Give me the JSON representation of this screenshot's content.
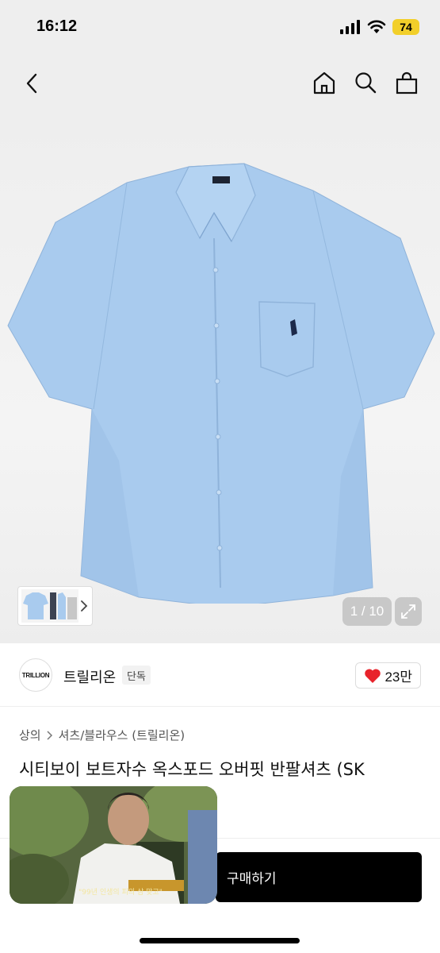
{
  "status_bar": {
    "time": "16:12",
    "battery": "74"
  },
  "gallery": {
    "counter": "1 / 10"
  },
  "brand": {
    "logo_text": "TRILLION",
    "name": "트릴리온",
    "tag": "단독",
    "likes": "23만"
  },
  "breadcrumb": {
    "category": "상의",
    "subcategory": "셔츠/블라우스 (트릴리온)"
  },
  "product": {
    "title": "시티보이 보트자수 옥스포드 오버핏 반팔셔츠 (SK"
  },
  "actions": {
    "buy_label": "구매하기"
  },
  "video": {
    "caption": "\"99년 인생의 피의 삼 맞고\""
  },
  "colors": {
    "shirt": "#a9cbee",
    "buy_button": "#000000",
    "heart": "#e8232b",
    "battery": "#f2cf2a"
  },
  "icons": [
    "signal-icon",
    "wifi-icon",
    "back-icon",
    "home-icon",
    "search-icon",
    "bag-icon",
    "chevron-right-icon",
    "expand-icon",
    "heart-icon"
  ]
}
